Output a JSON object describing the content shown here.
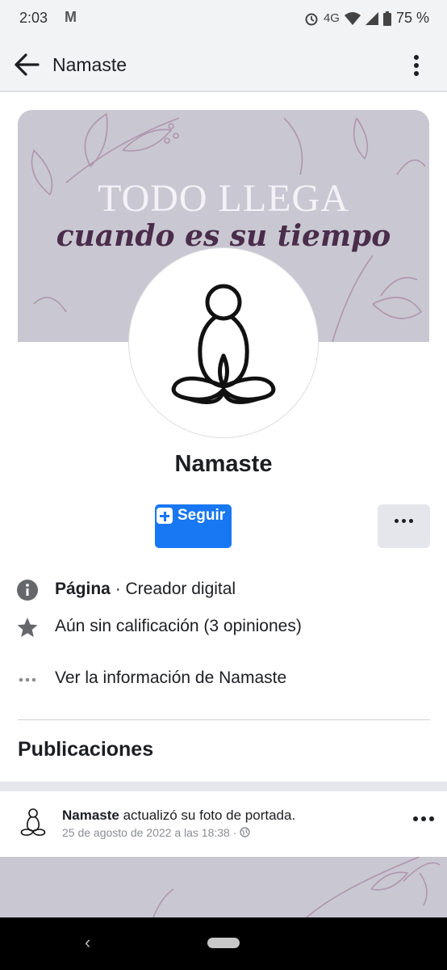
{
  "status_bar": {
    "time": "2:03",
    "mail_icon": "gmail-icon",
    "network": "4G",
    "battery": "75 %"
  },
  "app_bar": {
    "title": "Namaste"
  },
  "cover": {
    "line1": "TODO LLEGA",
    "line2": "cuando es su tiempo"
  },
  "profile": {
    "name": "Namaste",
    "follow_label": "Seguir"
  },
  "info": {
    "type_bold": "Página",
    "type_rest": " · Creador digital",
    "rating": "Aún sin calificación (3 opiniones)",
    "see_info": "Ver la información de Namaste"
  },
  "section_title": "Publicaciones",
  "post": {
    "author": "Namaste",
    "action": " actualizó su foto de portada.",
    "timestamp": "25 de agosto de 2022 a las 18:38 ·"
  },
  "colors": {
    "brand_blue": "#1877f2",
    "cover_bg": "#c9c7d2"
  }
}
